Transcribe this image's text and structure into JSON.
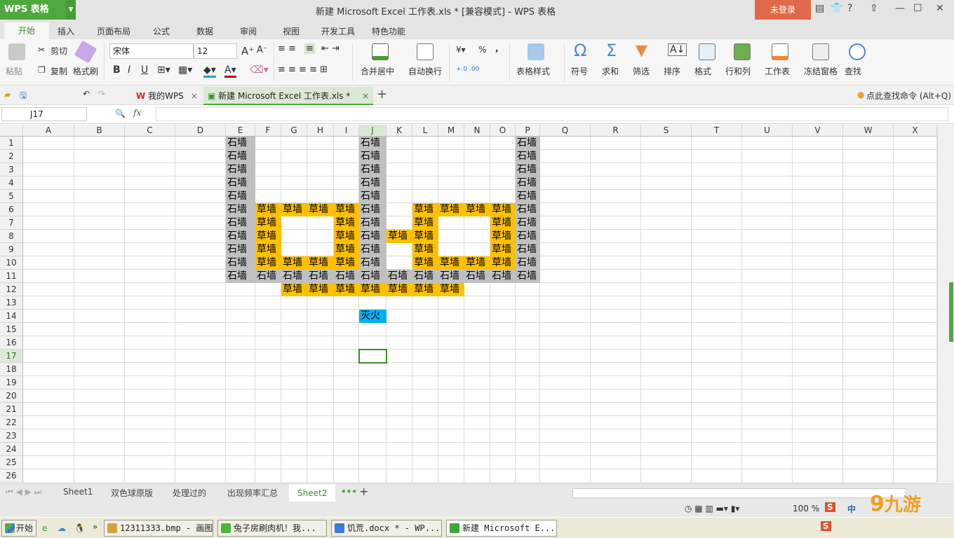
{
  "app": {
    "logo": "WPS 表格",
    "title": "新建 Microsoft Excel 工作表.xls * [兼容模式] - WPS 表格",
    "login": "未登录",
    "help": "?"
  },
  "menu": [
    "开始",
    "插入",
    "页面布局",
    "公式",
    "数据",
    "审阅",
    "视图",
    "开发工具",
    "特色功能"
  ],
  "ribbon": {
    "paste": "粘贴",
    "cut": "剪切",
    "copy": "复制",
    "format_painter": "格式刷",
    "font": "宋体",
    "font_size": "12",
    "bold": "B",
    "italic": "I",
    "underline": "U",
    "merge": "合并居中",
    "wrap": "自动换行",
    "table_style": "表格样式",
    "symbol": "符号",
    "sum": "求和",
    "filter": "筛选",
    "sort": "排序",
    "format": "格式",
    "rows_cols": "行和列",
    "worksheet": "工作表",
    "freeze": "冻结窗格",
    "find": "查找",
    "percent": "%",
    "comma": ","
  },
  "doc_tabs": {
    "my_wps": "我的WPS",
    "current": "新建 Microsoft Excel 工作表.xls *",
    "search_cmd": "点此查找命令 (Alt+Q)"
  },
  "formula": {
    "name_box": "J17",
    "fx": "fx",
    "value": ""
  },
  "columns": [
    "A",
    "B",
    "C",
    "D",
    "E",
    "F",
    "G",
    "H",
    "I",
    "J",
    "K",
    "L",
    "M",
    "N",
    "O",
    "P",
    "Q",
    "R",
    "S",
    "T",
    "U",
    "V",
    "W",
    "X"
  ],
  "rows": [
    "1",
    "2",
    "3",
    "4",
    "5",
    "6",
    "7",
    "8",
    "9",
    "10",
    "11",
    "12",
    "13",
    "14",
    "15",
    "16",
    "17",
    "18",
    "19",
    "20",
    "21",
    "22",
    "23",
    "24",
    "25",
    "26"
  ],
  "fills": {
    "石墙": "#c0c0c0",
    "草墙": "#ffc000",
    "灭火": "#00b0f0"
  },
  "cells": {
    "1": {
      "E": "石墙",
      "J": "石墙",
      "P": "石墙"
    },
    "2": {
      "E": "石墙",
      "J": "石墙",
      "P": "石墙"
    },
    "3": {
      "E": "石墙",
      "J": "石墙",
      "P": "石墙"
    },
    "4": {
      "E": "石墙",
      "J": "石墙",
      "P": "石墙"
    },
    "5": {
      "E": "石墙",
      "J": "石墙",
      "P": "石墙"
    },
    "6": {
      "E": "石墙",
      "F": "草墙",
      "G": "草墙",
      "H": "草墙",
      "I": "草墙",
      "J": "石墙",
      "L": "草墙",
      "M": "草墙",
      "N": "草墙",
      "O": "草墙",
      "P": "石墙"
    },
    "7": {
      "E": "石墙",
      "F": "草墙",
      "I": "草墙",
      "J": "石墙",
      "L": "草墙",
      "O": "草墙",
      "P": "石墙"
    },
    "8": {
      "E": "石墙",
      "F": "草墙",
      "I": "草墙",
      "J": "石墙",
      "K": "草墙",
      "L": "草墙",
      "O": "草墙",
      "P": "石墙"
    },
    "9": {
      "E": "石墙",
      "F": "草墙",
      "I": "草墙",
      "J": "石墙",
      "L": "草墙",
      "O": "草墙",
      "P": "石墙"
    },
    "10": {
      "E": "石墙",
      "F": "草墙",
      "G": "草墙",
      "H": "草墙",
      "I": "草墙",
      "J": "石墙",
      "L": "草墙",
      "M": "草墙",
      "N": "草墙",
      "O": "草墙",
      "P": "石墙"
    },
    "11": {
      "E": "石墙",
      "F": "石墙",
      "G": "石墙",
      "H": "石墙",
      "I": "石墙",
      "J": "石墙",
      "K": "石墙",
      "L": "石墙",
      "M": "石墙",
      "N": "石墙",
      "O": "石墙",
      "P": "石墙"
    },
    "12": {
      "G": "草墙",
      "H": "草墙",
      "I": "草墙",
      "J": "草墙",
      "K": "草墙",
      "L": "草墙",
      "M": "草墙"
    },
    "14": {
      "J": "灭火"
    }
  },
  "sheet_tabs": [
    "Sheet1",
    "双色球原版",
    "处理过的",
    "出现频率汇总",
    "Sheet2"
  ],
  "active_sheet": "Sheet2",
  "status": {
    "zoom": "100 %",
    "ime": "中"
  },
  "taskbar": {
    "start": "开始",
    "more": "»",
    "tasks": [
      "12311333.bmp - 画图",
      "兔子房刷肉机！我...",
      "饥荒.docx * - WP...",
      "新建 Microsoft E..."
    ]
  },
  "watermark": "九游"
}
